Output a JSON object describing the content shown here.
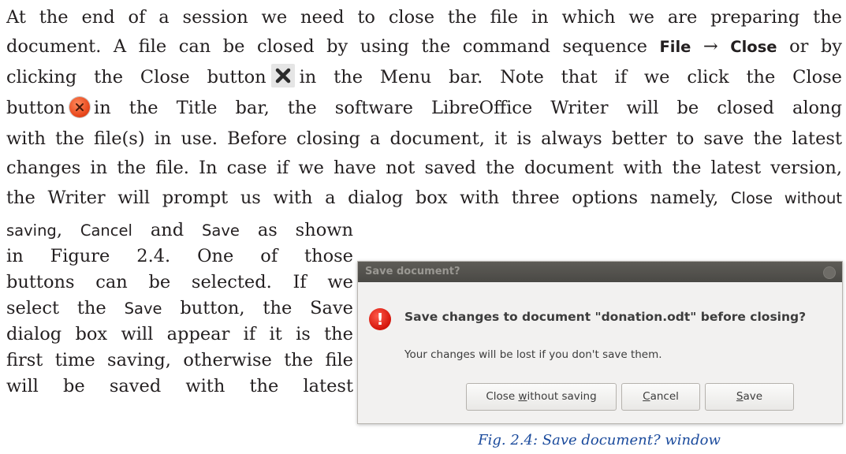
{
  "paragraph": {
    "l1": "At the end of a session we need to close the file in which we are preparing the",
    "l2a": "document. A file can be closed by using the command sequence",
    "l2_file": "File",
    "l2_arrow": "→",
    "l2_close": "Close",
    "l2b": "or by",
    "l3a": "clicking the Close button",
    "l3b": "in the Menu bar. Note that if we click the Close",
    "l4a": "button",
    "l4b": "in the Title bar, the software LibreOffice Writer will be closed along",
    "l5": "with the file(s) in use. Before closing a document, it is always better to save the latest",
    "l6": "changes in the file. In case if we have not saved the document with the latest version,",
    "l7a": "the Writer will prompt us with a dialog box with three options namely,",
    "l7_cws": "Close without",
    "l8_saving": "saving",
    "l8_cancel": "Cancel",
    "l8_and": "and",
    "l8_save": "Save",
    "l8b": "as shown",
    "l9": "in Figure 2.4. One of those",
    "l10": "buttons can be selected. If we",
    "l11a": "select the",
    "l11_save": "Save",
    "l11b": "button, the Save",
    "l12": "dialog box will appear if it is the",
    "l13": "first time saving, otherwise the file",
    "l14": "will be saved with the latest"
  },
  "dialog": {
    "title": "Save document?",
    "heading": "Save changes to document \"donation.odt\" before closing?",
    "message": "Your changes will be lost if you don't save them.",
    "buttons": {
      "close_without_saving": {
        "pre": "Close ",
        "mnemonic": "w",
        "post": "ithout saving"
      },
      "cancel": {
        "mnemonic": "C",
        "post": "ancel"
      },
      "save": {
        "mnemonic": "S",
        "post": "ave"
      }
    }
  },
  "caption": "Fig. 2.4: Save document? window",
  "icons": {
    "menu_close": "close-x-icon",
    "title_close": "close-circle-icon",
    "warning": "warning-icon"
  }
}
